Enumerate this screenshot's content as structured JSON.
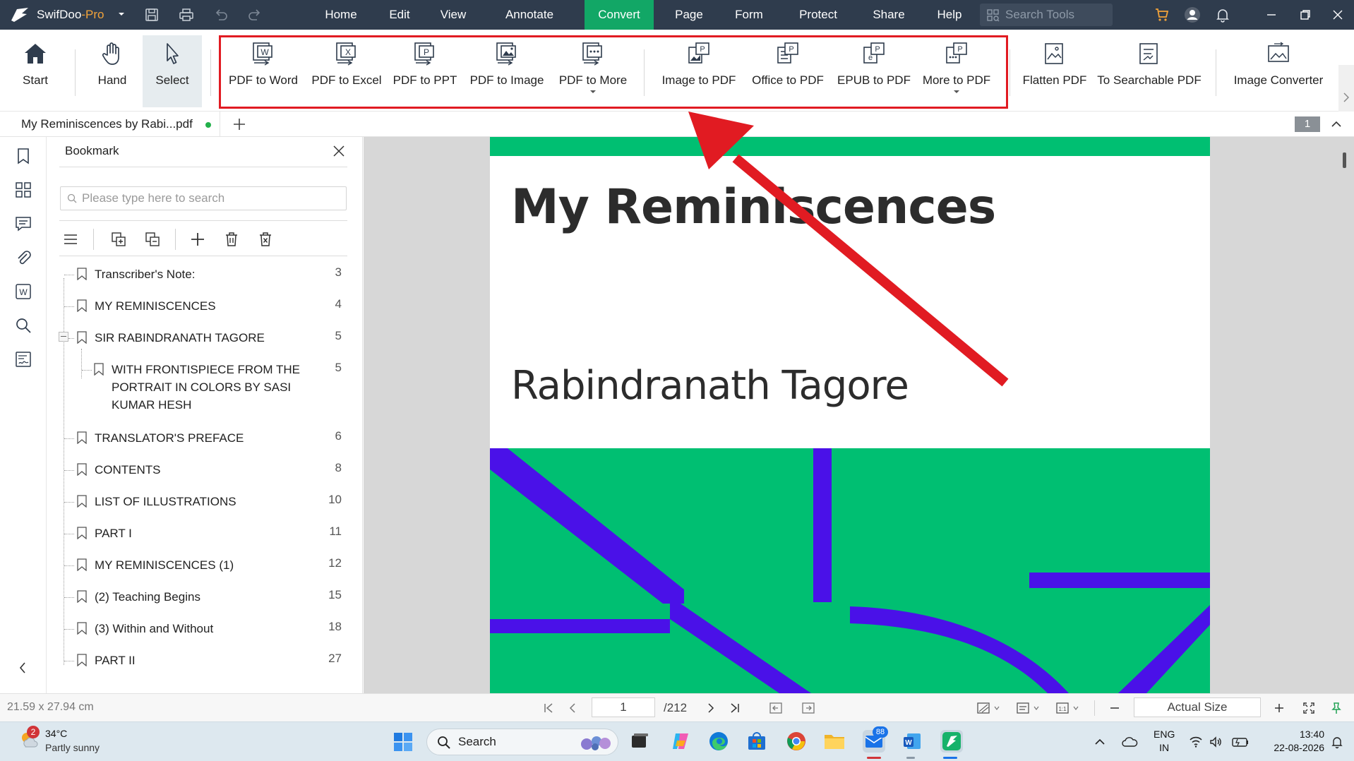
{
  "app": {
    "name_main": "SwifDoo",
    "name_suffix": "-Pro"
  },
  "menu": [
    "Home",
    "Edit",
    "View",
    "Annotate",
    "Convert",
    "Page",
    "Form",
    "Protect",
    "Share",
    "Help"
  ],
  "menu_active": "Convert",
  "search_tools": {
    "placeholder": "Search Tools"
  },
  "ribbon": {
    "start": "Start",
    "hand": "Hand",
    "select": "Select",
    "pdf_to_word": "PDF to Word",
    "pdf_to_excel": "PDF to Excel",
    "pdf_to_ppt": "PDF to PPT",
    "pdf_to_image": "PDF to Image",
    "pdf_to_more": "PDF to More",
    "image_to_pdf": "Image to PDF",
    "office_to_pdf": "Office to PDF",
    "epub_to_pdf": "EPUB to PDF",
    "more_to_pdf": "More to PDF",
    "flatten_pdf": "Flatten PDF",
    "to_searchable_pdf": "To Searchable PDF",
    "image_converter": "Image Converter"
  },
  "tab": {
    "title": "My Reminiscences by Rabi...pdf",
    "page_badge": "1"
  },
  "bookmark_panel": {
    "title": "Bookmark",
    "search_placeholder": "Please type here to search",
    "items": [
      {
        "label": "Transcriber's Note:",
        "page": "3"
      },
      {
        "label": "MY REMINISCENCES",
        "page": "4"
      },
      {
        "label": "SIR RABINDRANATH TAGORE",
        "page": "5"
      },
      {
        "label": "WITH FRONTISPIECE FROM THE PORTRAIT IN COLORS BY SASI KUMAR HESH",
        "page": "5"
      },
      {
        "label": "TRANSLATOR'S PREFACE",
        "page": "6"
      },
      {
        "label": "CONTENTS",
        "page": "8"
      },
      {
        "label": "LIST OF ILLUSTRATIONS",
        "page": "10"
      },
      {
        "label": "PART I",
        "page": "11"
      },
      {
        "label": "MY REMINISCENCES (1)",
        "page": "12"
      },
      {
        "label": "(2) Teaching Begins",
        "page": "15"
      },
      {
        "label": "(3) Within and Without",
        "page": "18"
      },
      {
        "label": "PART II",
        "page": "27"
      }
    ]
  },
  "document": {
    "title": "My Reminiscences",
    "author": "Rabindranath Tagore",
    "colors": {
      "green": "#00bf72",
      "purple": "#4a11e8"
    }
  },
  "statusbar": {
    "dimensions": "21.59 x 27.94 cm",
    "current_page": "1",
    "total_pages": "/212",
    "zoom": "Actual Size"
  },
  "taskbar": {
    "weather_badge": "2",
    "temperature": "34°C",
    "weather": "Partly sunny",
    "search": "Search",
    "mail_badge": "88",
    "lang_line1": "ENG",
    "lang_line2": "IN",
    "time": "13:40",
    "date": "22-08-2026"
  },
  "accent_color": "#12a766",
  "highlight_color": "#e11b22"
}
